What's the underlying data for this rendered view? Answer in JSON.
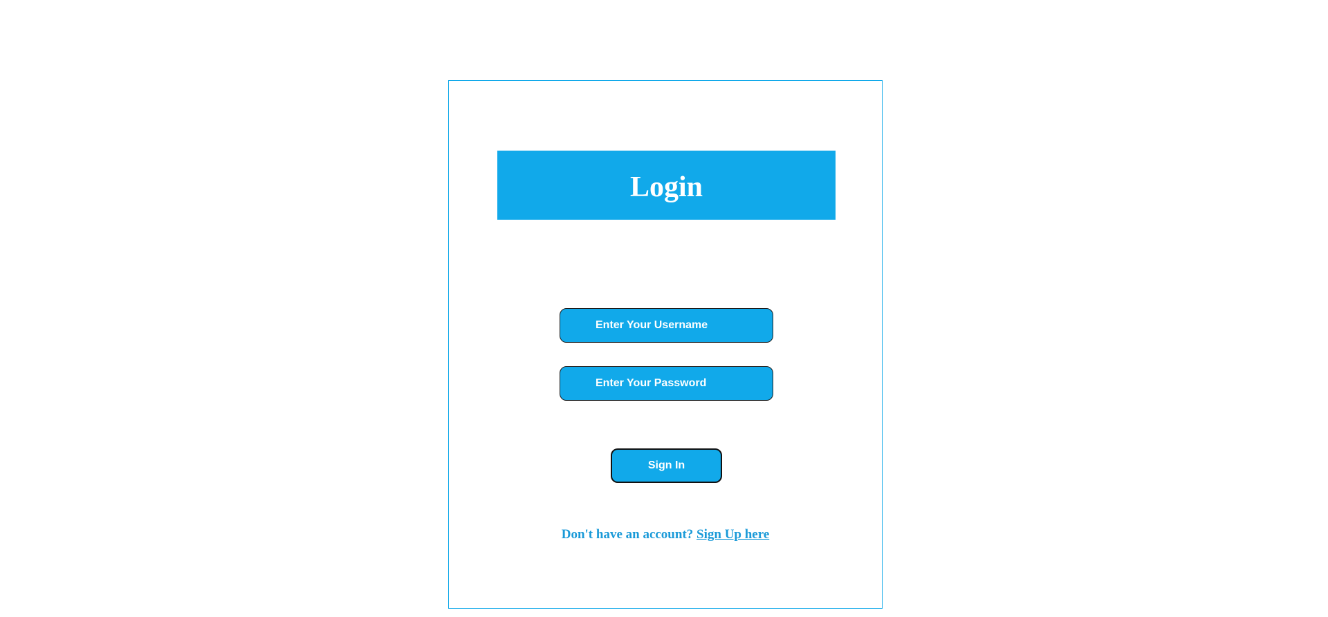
{
  "login_card": {
    "title": "Login",
    "username": {
      "value": "",
      "placeholder": "Enter Your Username"
    },
    "password": {
      "value": "",
      "placeholder": "Enter Your Password"
    },
    "sign_in_label": "Sign In",
    "footer": {
      "prompt": "Don't have an account?",
      "signup_link": "Sign Up here"
    }
  },
  "colors": {
    "accent": "#11a9ea",
    "footer_text": "#1a9ad8",
    "field_border": "#1c1c1c",
    "background": "#ffffff"
  }
}
